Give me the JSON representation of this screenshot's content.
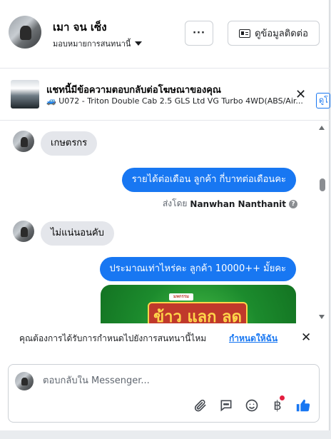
{
  "header": {
    "contact_name": "เมา จน เซ็ง",
    "assign_label": "มอบหมายการสนทนานี้",
    "more_label": "···",
    "contact_info_label": "ดูข้อมูลติดต่อ"
  },
  "ad": {
    "title": "แชทนี้มีข้อความตอบกลับต่อโฆษณาของคุณ",
    "subtitle": "🚙 U072 - Triton Double Cab 2.5 GLS Ltd VG Turbo 4WD(ABS/Air...",
    "tab_label": "ดูโ"
  },
  "messages": [
    {
      "direction": "in",
      "text": "เกษตรกร"
    },
    {
      "direction": "out",
      "text": "รายได้ต่อเดือน  ลูกค้า   กี่บาทต่อเดือนคะ"
    },
    {
      "direction": "meta",
      "sent_by_label": "ส่งโดย",
      "sent_by_name": "Nanwhan Nanthanit"
    },
    {
      "direction": "in",
      "text": "ไม่แน่นอนคับ"
    },
    {
      "direction": "out",
      "text": "ประมาณเท่าไหร่คะ  ลูกค้า   10000++ มั้ยคะ"
    }
  ],
  "promo": {
    "top_text": "มหกรรม",
    "main_text": "ข้าว แลก ลด"
  },
  "notice": {
    "text": "คุณต้องการได้รับการกำหนดไปยังการสนทนานี้ไหม",
    "link": "กำหนดให้ฉัน"
  },
  "composer": {
    "placeholder": "ตอบกลับใน Messenger..."
  },
  "colors": {
    "accent": "#1877f2",
    "incoming_bubble": "#e4e6eb",
    "badge": "#e41e3f"
  }
}
